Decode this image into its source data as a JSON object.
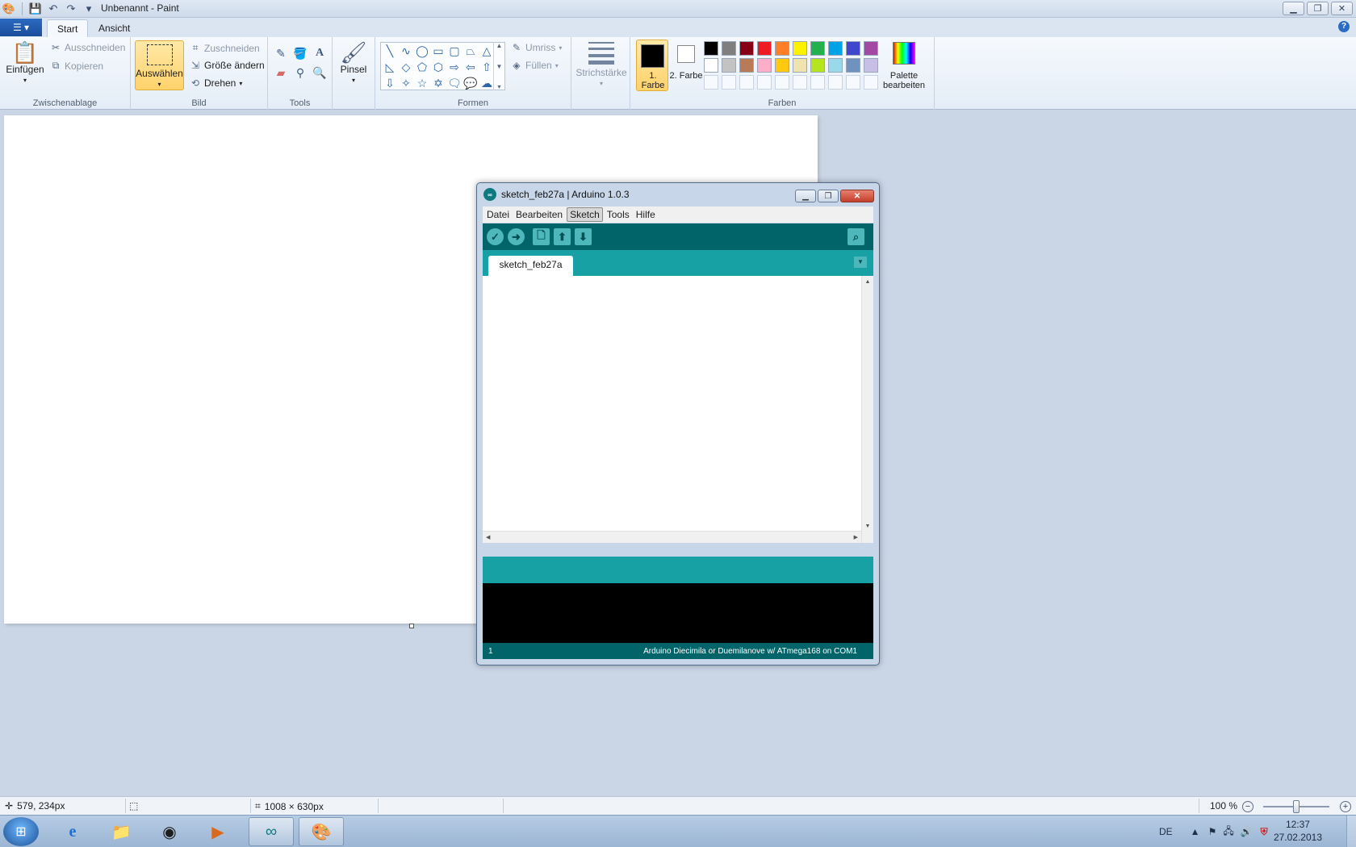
{
  "paint": {
    "title": "Unbenannt - Paint",
    "quick_access": {
      "save_icon": "save-icon",
      "undo_icon": "undo-icon",
      "redo_icon": "redo-icon",
      "customize_icon": "chevron-down-icon"
    },
    "window_buttons": [
      "▁",
      "❐",
      "✕"
    ],
    "file_button_glyph": "☰ ▾",
    "tabs": [
      {
        "label": "Start",
        "active": true
      },
      {
        "label": "Ansicht",
        "active": false
      }
    ],
    "help_glyph": "?",
    "ribbon": {
      "zwischenablage": {
        "label": "Zwischenablage",
        "paste": "Einfügen",
        "cut": "Ausschneiden",
        "copy": "Kopieren"
      },
      "bild": {
        "label": "Bild",
        "select": "Auswählen",
        "crop": "Zuschneiden",
        "resize": "Größe ändern",
        "rotate": "Drehen"
      },
      "tools": {
        "label": "Tools"
      },
      "brush": {
        "label": "Pinsel"
      },
      "formen": {
        "label": "Formen",
        "outline": "Umriss",
        "fill": "Füllen"
      },
      "strichstaerke": {
        "label": "Strichstärke"
      },
      "farben": {
        "label": "Farben",
        "color1": "1. Farbe",
        "color2": "2. Farbe",
        "color1_value": "#000000",
        "color2_value": "#ffffff",
        "palette_edit": "Palette bearbeiten",
        "row1": [
          "#000000",
          "#7f7f7f",
          "#880015",
          "#ed1c24",
          "#ff7f27",
          "#fff200",
          "#22b14c",
          "#00a2e8",
          "#3f48cc",
          "#a349a4"
        ],
        "row2": [
          "#ffffff",
          "#c3c3c3",
          "#b97a57",
          "#ffaec9",
          "#ffc90e",
          "#efe4b0",
          "#b5e61d",
          "#99d9ea",
          "#7092be",
          "#c8bfe7"
        ]
      }
    },
    "status": {
      "cursor_pos": "579, 234px",
      "image_size": "1008 × 630px",
      "zoom": "100 %",
      "zoom_level": 1.0
    }
  },
  "arduino": {
    "title": "sketch_feb27a | Arduino 1.0.3",
    "logo_glyph": "∞",
    "window_buttons": [
      "▁",
      "❐",
      "✕"
    ],
    "menu": [
      {
        "label": "Datei",
        "active": false
      },
      {
        "label": "Bearbeiten",
        "active": false
      },
      {
        "label": "Sketch",
        "active": true
      },
      {
        "label": "Tools",
        "active": false
      },
      {
        "label": "Hilfe",
        "active": false
      }
    ],
    "tab": "sketch_feb27a",
    "line_number": "1",
    "board_info": "Arduino Diecimila or Duemilanove w/ ATmega168 on COM1"
  },
  "taskbar": {
    "apps": [
      "internet-explorer-icon",
      "file-explorer-icon",
      "chrome-icon",
      "media-player-icon",
      "arduino-icon",
      "paint-icon"
    ],
    "language": "DE",
    "time": "12:37",
    "date": "27.02.2013"
  }
}
